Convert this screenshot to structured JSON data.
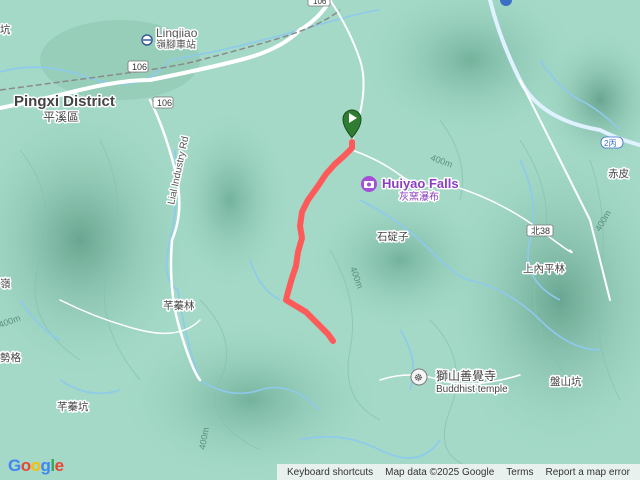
{
  "places": {
    "pingxi_en": "Pingxi District",
    "pingxi_zh": "平溪區",
    "lingjiao_en": "Lingjiao",
    "lingjiao_zh": "嶺腳車站",
    "huiyao_en": "Huiyao Falls",
    "huiyao_zh": "灰窯瀑布",
    "shidingzi": "石碇子",
    "shangneipinglin": "上內平林",
    "temple_zh": "獅山善覺寺",
    "temple_en": "Buddhist temple",
    "panshankeng": "盤山坑",
    "qinglinlin": "芊蓁林",
    "qinglinkeng": "芊蓁坑",
    "shige": "勢格",
    "ling": "嶺",
    "chipi": "赤皮",
    "keng_top_left": "坑",
    "industry_rd": "Lial Industry Rd"
  },
  "roads": {
    "r106_a": "106",
    "r106_b": "106",
    "r106_top": "106",
    "r2": "2丙",
    "bei38": "北38"
  },
  "contours": {
    "c400_a": "400m",
    "c400_b": "400m",
    "c400_c": "400m",
    "c400_d": "400m",
    "c400_e": "400m"
  },
  "footer": {
    "keyboard": "Keyboard shortcuts",
    "mapdata": "Map data ©2025 Google",
    "terms": "Terms",
    "report": "Report a map error"
  },
  "logo": {
    "g": "G",
    "o1": "o",
    "o2": "o",
    "g2": "g",
    "l": "l",
    "e": "e"
  },
  "colors": {
    "terrain": "#9fd6c4",
    "track": "#ff5a5a",
    "river": "#8fc8ee",
    "road": "#ffffff",
    "poi": "#a44fd6"
  }
}
